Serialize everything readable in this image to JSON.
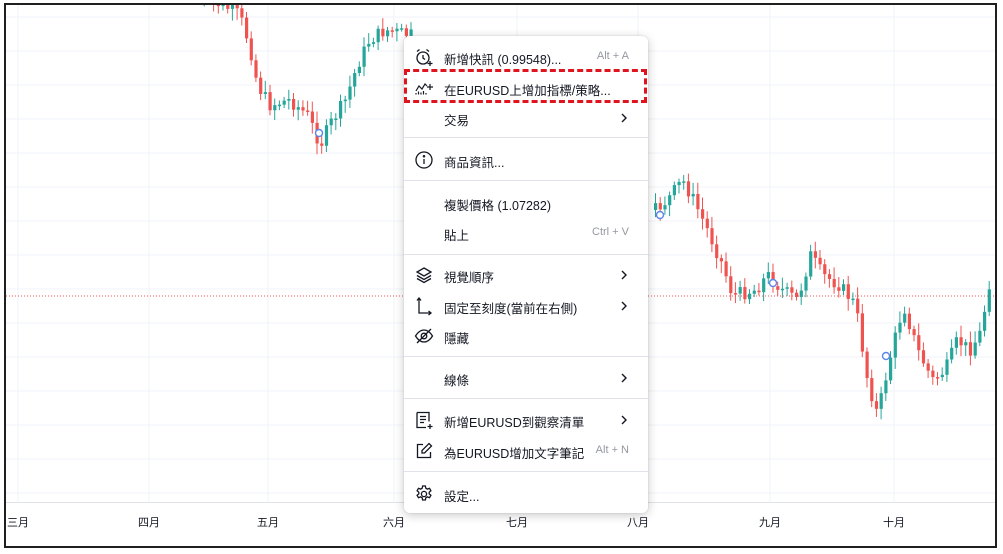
{
  "time_axis": {
    "labels": [
      "三月",
      "四月",
      "五月",
      "六月",
      "七月",
      "八月",
      "九月",
      "十月"
    ]
  },
  "menu": {
    "items": [
      {
        "id": "add-alert",
        "icon": "alarm-plus-icon",
        "label": "新增快訊 (0.99548)...",
        "shortcut": "Alt + A"
      },
      {
        "id": "add-indicator",
        "icon": "indicator-plus-icon",
        "label": "在EURUSD上增加指標/策略...",
        "shortcut": ""
      },
      {
        "id": "trade",
        "icon": "",
        "label": "交易",
        "submenu": true
      },
      {
        "id": "symbol-info",
        "icon": "info-icon",
        "label": "商品資訊..."
      },
      {
        "id": "copy-price",
        "icon": "",
        "label": "複製價格 (1.07282)"
      },
      {
        "id": "paste",
        "icon": "",
        "label": "貼上",
        "shortcut": "Ctrl + V"
      },
      {
        "id": "visual-order",
        "icon": "layers-icon",
        "label": "視覺順序",
        "submenu": true
      },
      {
        "id": "pin-scale",
        "icon": "pin-to-scale-icon",
        "label": "固定至刻度(當前在右側)",
        "submenu": true
      },
      {
        "id": "hide",
        "icon": "eye-hidden-icon",
        "label": "隱藏"
      },
      {
        "id": "lines",
        "icon": "",
        "label": "線條",
        "submenu": true
      },
      {
        "id": "add-watchlist",
        "icon": "list-plus-icon",
        "label": "新增EURUSD到觀察清單",
        "submenu": true
      },
      {
        "id": "add-note",
        "icon": "note-edit-icon",
        "label": "為EURUSD增加文字筆記",
        "shortcut": "Alt + N"
      },
      {
        "id": "settings",
        "icon": "gear-icon",
        "label": "設定..."
      }
    ]
  },
  "colors": {
    "up": "#26a69a",
    "down": "#ef5350",
    "price_line": "#ef5350",
    "highlight": "#e0141e",
    "marker": "#5b86e5"
  }
}
